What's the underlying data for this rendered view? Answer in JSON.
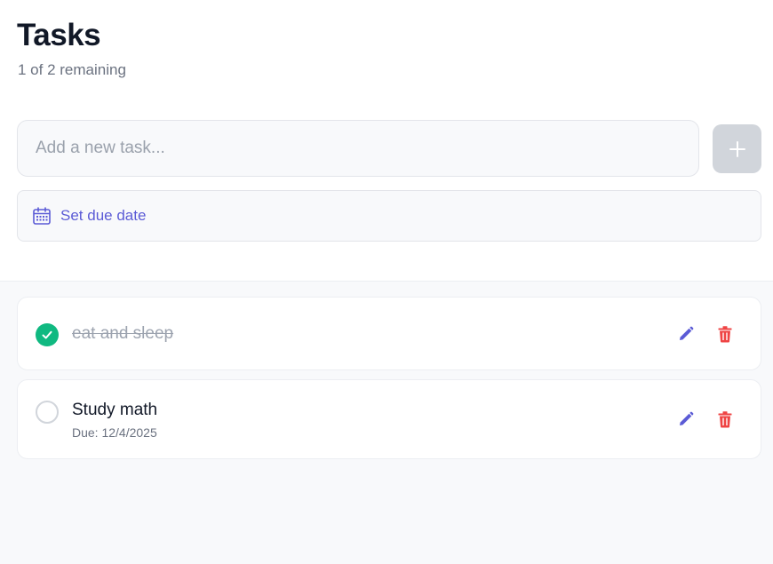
{
  "header": {
    "title": "Tasks",
    "remaining": "1 of 2 remaining"
  },
  "new_task": {
    "placeholder": "Add a new task...",
    "value": "",
    "add_icon": "plus-icon"
  },
  "due_date": {
    "label": "Set due date",
    "icon": "calendar-icon"
  },
  "tasks": [
    {
      "text": "eat and sleep",
      "completed": true,
      "due": ""
    },
    {
      "text": "Study math",
      "completed": false,
      "due": "Due: 12/4/2025"
    }
  ],
  "colors": {
    "accent": "#5b5bd6",
    "success": "#10b981",
    "danger": "#ef4444"
  }
}
